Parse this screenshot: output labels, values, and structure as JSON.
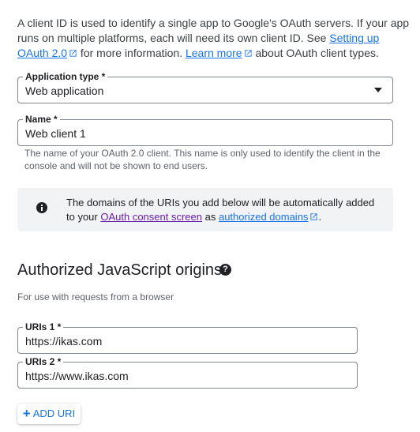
{
  "intro": {
    "text1": "A client ID is used to identify a single app to Google's OAuth servers. If your app runs on multiple platforms, each will need its own client ID. See ",
    "link1": "Setting up OAuth 2.0",
    "text2": " for more information. ",
    "link2": "Learn more",
    "text3": " about OAuth client types."
  },
  "application_type": {
    "label": "Application type *",
    "value": "Web application"
  },
  "name": {
    "label": "Name *",
    "value": "Web client 1",
    "helper": "The name of your OAuth 2.0 client. This name is only used to identify the client in the console and will not be shown to end users."
  },
  "info": {
    "text1": "The domains of the URIs you add below will be automatically added to your ",
    "link_consent": "OAuth consent screen",
    "text2": " as ",
    "link_domains": "authorized domains",
    "text3": "."
  },
  "js_origins": {
    "title": "Authorized JavaScript origins",
    "subtitle": "For use with requests from a browser",
    "uris": [
      {
        "label": "URIs 1 *",
        "value": "https://ikas.com"
      },
      {
        "label": "URIs 2 *",
        "value": "https://www.ikas.com"
      }
    ],
    "add_button": "ADD URI"
  },
  "colors": {
    "link": "#1a73e8",
    "visited_link": "#681da8",
    "info_bg": "#f1f3f4"
  }
}
